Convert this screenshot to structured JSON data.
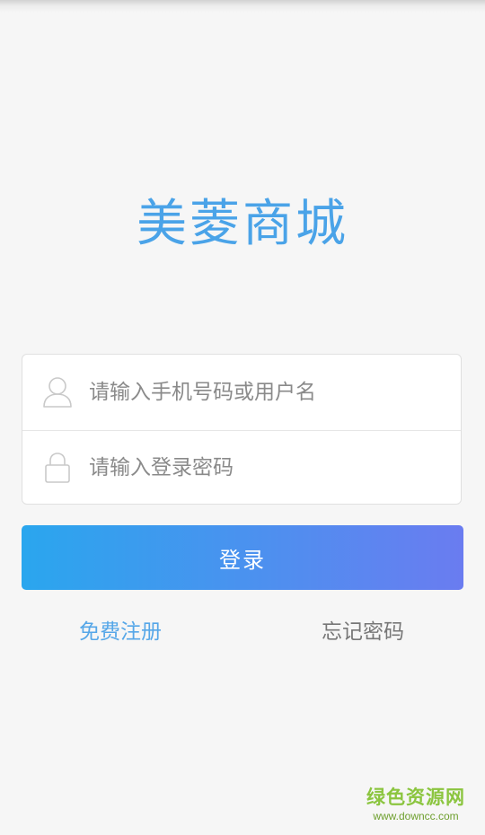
{
  "app": {
    "title": "美菱商城",
    "brand_color": "#4aa3e8"
  },
  "login_form": {
    "username": {
      "placeholder": "请输入手机号码或用户名",
      "value": "",
      "icon": "user-icon"
    },
    "password": {
      "placeholder": "请输入登录密码",
      "value": "",
      "icon": "lock-icon"
    },
    "submit_label": "登录",
    "button_gradient": [
      "#2aa6ee",
      "#6a7cf0"
    ]
  },
  "links": {
    "register": "免费注册",
    "forgot_password": "忘记密码"
  },
  "watermark": {
    "main": "绿色资源网",
    "sub": "www.downcc.com"
  }
}
